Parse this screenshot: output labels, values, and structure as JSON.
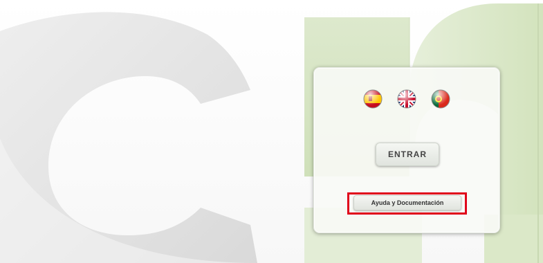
{
  "login_panel": {
    "languages": [
      {
        "code": "es",
        "icon": "spain-flag-icon"
      },
      {
        "code": "en",
        "icon": "uk-flag-icon"
      },
      {
        "code": "pt",
        "icon": "portugal-flag-icon"
      }
    ],
    "enter_label": "ENTRAR",
    "help_label": "Ayuda y Documentación"
  },
  "colors": {
    "background_letter": "#e4e4e4",
    "green_shapes": "#d9e7c6",
    "highlight": "#e0001a"
  }
}
